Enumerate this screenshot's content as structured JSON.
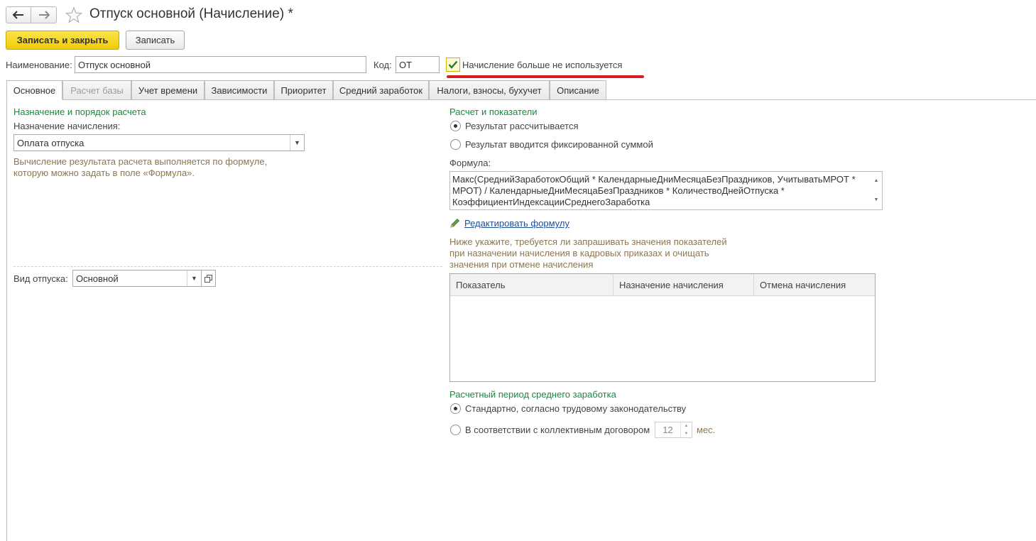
{
  "window": {
    "title": "Отпуск основной (Начисление) *"
  },
  "toolbar": {
    "save_close_label": "Записать и закрыть",
    "save_label": "Записать"
  },
  "header": {
    "name_label": "Наименование:",
    "name_value": "Отпуск основной",
    "code_label": "Код:",
    "code_value": "ОТ",
    "not_used_label": "Начисление больше не используется",
    "not_used_checked": true
  },
  "tabs": [
    {
      "label": "Основное",
      "active": true,
      "disabled": false
    },
    {
      "label": "Расчет базы",
      "active": false,
      "disabled": true
    },
    {
      "label": "Учет времени",
      "active": false,
      "disabled": false
    },
    {
      "label": "Зависимости",
      "active": false,
      "disabled": false
    },
    {
      "label": "Приоритет",
      "active": false,
      "disabled": false
    },
    {
      "label": "Средний заработок",
      "active": false,
      "disabled": false
    },
    {
      "label": "Налоги, взносы, бухучет",
      "active": false,
      "disabled": false
    },
    {
      "label": "Описание",
      "active": false,
      "disabled": false
    }
  ],
  "left": {
    "group_title": "Назначение и порядок расчета",
    "purpose_label": "Назначение начисления:",
    "purpose_value": "Оплата отпуска",
    "hint_line1": "Вычисление результата расчета выполняется по формуле,",
    "hint_line2": "которую можно задать в поле «Формула».",
    "vacation_type_label": "Вид отпуска:",
    "vacation_type_value": "Основной"
  },
  "right": {
    "group_title": "Расчет и показатели",
    "radio_calculated": "Результат рассчитывается",
    "radio_fixed": "Результат вводится фиксированной суммой",
    "radio_selected": "calculated",
    "formula_label": "Формула:",
    "formula_line1": "Макс(СреднийЗаработокОбщий * КалендарныеДниМесяцаБезПраздников, УчитыватьМРОТ *",
    "formula_line2": "МРОТ) / КалендарныеДниМесяцаБезПраздников * КоличествоДнейОтпуска *",
    "formula_line3": "КоэффициентИндексацииСреднегоЗаработка",
    "edit_formula_link": "Редактировать формулу",
    "hint_line1": "Ниже укажите, требуется ли запрашивать значения показателей",
    "hint_line2": "при назначении начисления в кадровых приказах и очищать",
    "hint_line3": "значения при отмене начисления",
    "table_columns": [
      "Показатель",
      "Назначение начисления",
      "Отмена начисления"
    ],
    "table_rows": [],
    "period_title": "Расчетный период среднего заработка",
    "period_standard": "Стандартно, согласно трудовому законодательству",
    "period_collective": "В соответствии с коллективным договором",
    "period_selected": "standard",
    "months_value": "12",
    "months_unit": "мес."
  },
  "colors": {
    "accent_yellow": "#f4d21a",
    "group_title_green": "#1a8a3e",
    "hint_brown": "#8c7651",
    "highlight_red": "#d81e1e",
    "link_blue": "#1f4e9b"
  },
  "icons": {
    "back": "arrow-left-icon",
    "forward": "arrow-right-icon",
    "favorite": "star-outline-icon",
    "checkbox": "checkmark-icon",
    "dropdown": "triangle-down-icon",
    "open": "open-window-icon",
    "edit": "pencil-icon"
  }
}
